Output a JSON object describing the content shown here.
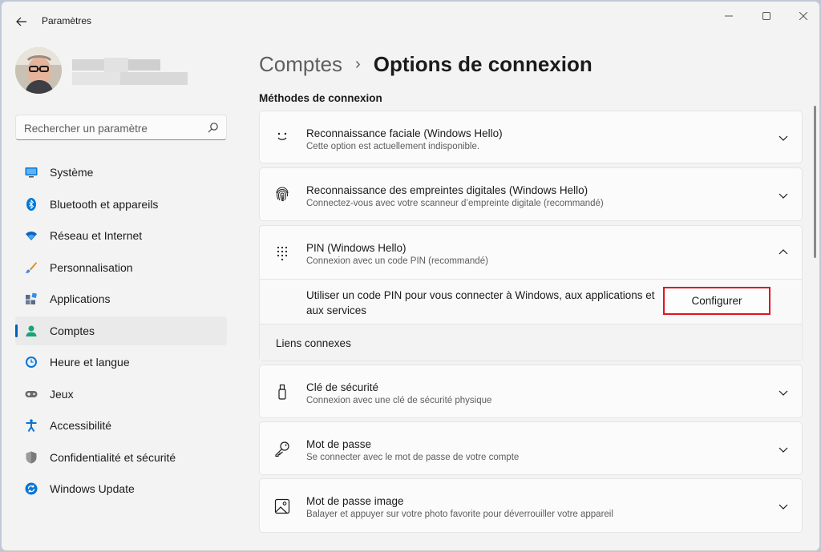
{
  "window": {
    "title": "Paramètres",
    "back_icon": "arrow-left-icon",
    "controls": [
      "minimize-icon",
      "maximize-icon",
      "close-icon"
    ]
  },
  "search": {
    "placeholder": "Rechercher un paramètre",
    "icon": "search-icon"
  },
  "sidebar": {
    "items": [
      {
        "label": "Système",
        "icon": "system-icon",
        "color": "#0a74d4"
      },
      {
        "label": "Bluetooth et appareils",
        "icon": "bluetooth-icon",
        "color": "#0078d4"
      },
      {
        "label": "Réseau et Internet",
        "icon": "wifi-icon",
        "color": "#0a66c2"
      },
      {
        "label": "Personnalisation",
        "icon": "brush-icon",
        "color": "#e08a2a"
      },
      {
        "label": "Applications",
        "icon": "apps-icon",
        "color": "#5a6b8a"
      },
      {
        "label": "Comptes",
        "icon": "account-icon",
        "color": "#1aa37a",
        "active": true
      },
      {
        "label": "Heure et langue",
        "icon": "clock-globe-icon",
        "color": "#0a74d4"
      },
      {
        "label": "Jeux",
        "icon": "gamepad-icon",
        "color": "#6b6b6b"
      },
      {
        "label": "Accessibilité",
        "icon": "accessibility-icon",
        "color": "#0a74d4"
      },
      {
        "label": "Confidentialité et sécurité",
        "icon": "shield-icon",
        "color": "#7a7a7a"
      },
      {
        "label": "Windows Update",
        "icon": "update-icon",
        "color": "#0a74d4"
      }
    ]
  },
  "breadcrumb": {
    "parent": "Comptes",
    "separator": "›",
    "current": "Options de connexion"
  },
  "section_title": "Méthodes de connexion",
  "methods": [
    {
      "title": "Reconnaissance faciale (Windows Hello)",
      "subtitle": "Cette option est actuellement indisponible.",
      "icon": "face-icon",
      "chevron": "chevron-down-icon"
    },
    {
      "title": "Reconnaissance des empreintes digitales (Windows Hello)",
      "subtitle": "Connectez-vous avec votre scanneur d’empreinte digitale (recommandé)",
      "icon": "fingerprint-icon",
      "chevron": "chevron-down-icon"
    },
    {
      "title": "PIN (Windows Hello)",
      "subtitle": "Connexion avec un code PIN (recommandé)",
      "icon": "keypad-icon",
      "chevron": "chevron-up-icon"
    },
    {
      "title": "Clé de sécurité",
      "subtitle": "Connexion avec une clé de sécurité physique",
      "icon": "usb-key-icon",
      "chevron": "chevron-down-icon"
    },
    {
      "title": "Mot de passe",
      "subtitle": "Se connecter avec le mot de passe de votre compte",
      "icon": "key-icon",
      "chevron": "chevron-down-icon"
    },
    {
      "title": "Mot de passe image",
      "subtitle": "Balayer et appuyer sur votre photo favorite pour déverrouiller votre appareil",
      "icon": "picture-icon",
      "chevron": "chevron-down-icon"
    }
  ],
  "pin_panel": {
    "description": "Utiliser un code PIN pour vous connecter à Windows, aux applications et aux services",
    "button_label": "Configurer",
    "highlight_color": "#e0141e"
  },
  "related_links_label": "Liens connexes",
  "accent_color": "#005fb8"
}
